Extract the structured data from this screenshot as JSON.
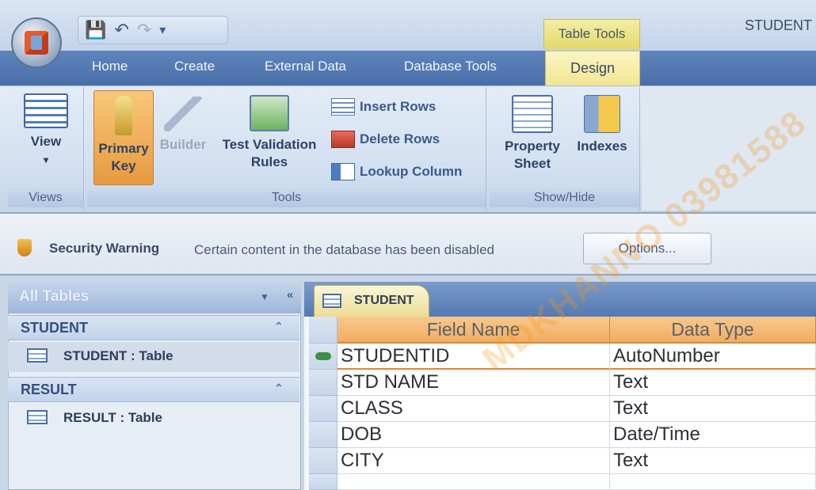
{
  "window": {
    "title": "STUDENT",
    "context_tab": "Table Tools"
  },
  "ribbon_tabs": [
    "Home",
    "Create",
    "External Data",
    "Database Tools",
    "Design"
  ],
  "views_group": {
    "label": "Views",
    "view_label": "View"
  },
  "tools_group": {
    "label": "Tools",
    "primary_key": "Primary Key",
    "builder": "Builder",
    "test_validation": "Test Validation Rules",
    "insert_rows": "Insert Rows",
    "delete_rows": "Delete Rows",
    "lookup_column": "Lookup Column"
  },
  "showhide_group": {
    "label": "Show/Hide",
    "property_sheet": "Property Sheet",
    "indexes": "Indexes"
  },
  "security": {
    "title": "Security Warning",
    "message": "Certain content in the database has been disabled",
    "options_label": "Options..."
  },
  "nav_pane": {
    "header": "All Tables",
    "groups": [
      {
        "name": "STUDENT",
        "item": "STUDENT : Table"
      },
      {
        "name": "RESULT",
        "item": "RESULT : Table"
      }
    ]
  },
  "document": {
    "tab_label": "STUDENT",
    "columns": [
      "Field Name",
      "Data Type"
    ],
    "rows": [
      {
        "field": "STUDENTID",
        "type": "AutoNumber"
      },
      {
        "field": "STD NAME",
        "type": "Text"
      },
      {
        "field": "CLASS",
        "type": "Text"
      },
      {
        "field": "DOB",
        "type": "Date/Time"
      },
      {
        "field": "CITY",
        "type": "Text"
      }
    ]
  },
  "watermark": "MDKHANNO 03981588"
}
